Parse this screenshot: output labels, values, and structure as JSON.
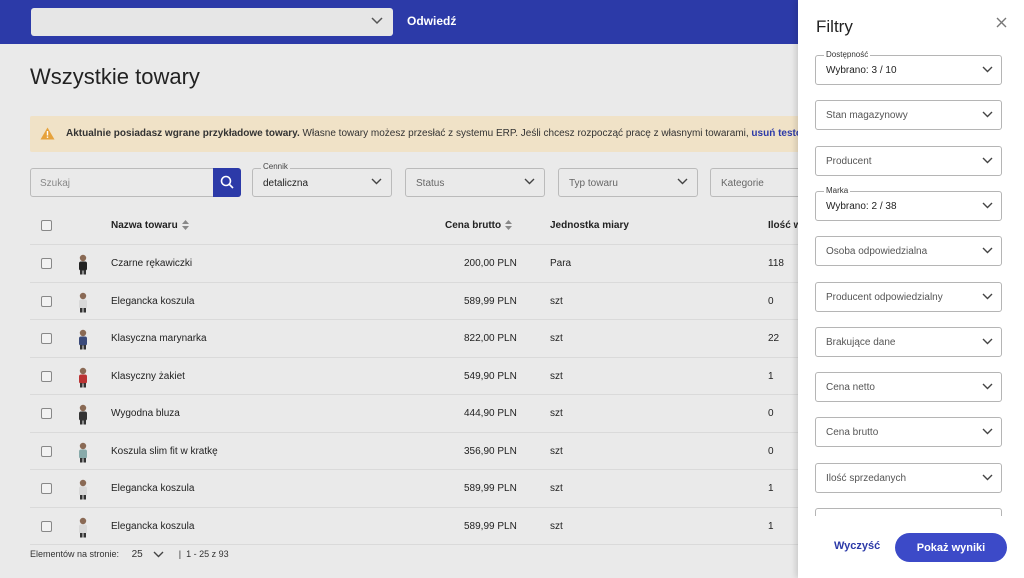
{
  "topbar": {
    "site_select_value": "",
    "visit_label": "Odwiedź"
  },
  "page": {
    "title": "Wszystkie towary",
    "banner": {
      "bold": "Aktualnie posiadasz wgrane przykładowe towary.",
      "text": " Własne towary możesz przesłać z systemu ERP. Jeśli chcesz rozpocząć pracę z własnymi towarami, ",
      "link": "usuń testowe to"
    }
  },
  "filters": {
    "search_placeholder": "Szukaj",
    "cennik_label": "Cennik",
    "cennik_value": "detaliczna",
    "status": "Status",
    "typ": "Typ towaru",
    "kategorie": "Kategorie"
  },
  "table": {
    "headers": {
      "name": "Nazwa towaru",
      "price": "Cena brutto",
      "unit": "Jednostka miary",
      "qty": "Ilość w"
    },
    "rows": [
      {
        "name": "Czarne rękawiczki",
        "price": "200,00 PLN",
        "unit": "Para",
        "qty": "118"
      },
      {
        "name": "Elegancka koszula",
        "price": "589,99 PLN",
        "unit": "szt",
        "qty": "0"
      },
      {
        "name": "Klasyczna marynarka",
        "price": "822,00 PLN",
        "unit": "szt",
        "qty": "22"
      },
      {
        "name": "Klasyczny żakiet",
        "price": "549,90 PLN",
        "unit": "szt",
        "qty": "1"
      },
      {
        "name": "Wygodna bluza",
        "price": "444,90 PLN",
        "unit": "szt",
        "qty": "0"
      },
      {
        "name": "Koszula slim fit w kratkę",
        "price": "356,90 PLN",
        "unit": "szt",
        "qty": "0"
      },
      {
        "name": "Elegancka koszula",
        "price": "589,99 PLN",
        "unit": "szt",
        "qty": "1"
      },
      {
        "name": "Elegancka koszula",
        "price": "589,99 PLN",
        "unit": "szt",
        "qty": "1"
      }
    ]
  },
  "pager": {
    "label": "Elementów na stronie:",
    "per_page": "25",
    "range": "1 - 25 z 93"
  },
  "drawer": {
    "title": "Filtry",
    "selects": [
      {
        "label": "Dostępność",
        "value": "Wybrano: 3 / 10"
      },
      {
        "label": "",
        "value": "Stan magazynowy"
      },
      {
        "label": "",
        "value": "Producent"
      },
      {
        "label": "Marka",
        "value": "Wybrano: 2  / 38"
      },
      {
        "label": "",
        "value": "Osoba odpowiedzialna"
      },
      {
        "label": "",
        "value": "Producent odpowiedzialny"
      },
      {
        "label": "",
        "value": "Brakujące dane"
      },
      {
        "label": "",
        "value": "Cena netto"
      },
      {
        "label": "",
        "value": "Cena brutto"
      },
      {
        "label": "",
        "value": "Ilość sprzedanych"
      }
    ],
    "clear_label": "Wyczyść",
    "show_label": "Pokaż wyniki"
  },
  "colors": {
    "brand": "#2c3aa8",
    "banner_bg": "#f0e2c7",
    "warning": "#e6a23c"
  }
}
